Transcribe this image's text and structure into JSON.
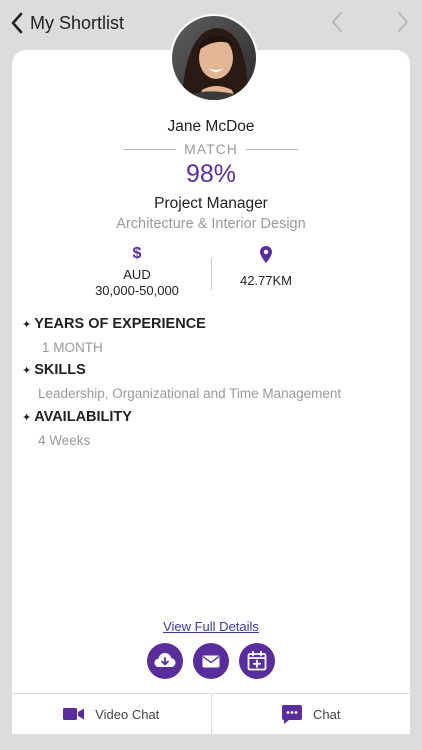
{
  "header": {
    "back_label": "My Shortlist",
    "icons": {
      "back": "chevron-left-icon",
      "prev": "chevron-left-icon",
      "next": "chevron-right-icon"
    }
  },
  "candidate": {
    "name": "Jane McDoe",
    "match_label": "MATCH",
    "match_percent": "98%",
    "job_title": "Project Manager",
    "industry": "Architecture & Interior Design",
    "salary_symbol": "$",
    "salary_currency": "AUD",
    "salary_range": "30,000-50,000",
    "distance": "42.77KM"
  },
  "sections": {
    "experience_title": "YEARS OF EXPERIENCE",
    "experience_value": "1  MONTH",
    "skills_title": "SKILLS",
    "skills_value": "Leadership, Organizational and Time Management",
    "availability_title": "AVAILABILITY",
    "availability_value": "4 Weeks",
    "bullet": "✦"
  },
  "actions": {
    "view_details": "View Full Details",
    "icons": [
      "cloud-download-icon",
      "mail-icon",
      "calendar-add-icon"
    ]
  },
  "bottom": {
    "video_chat": "Video Chat",
    "chat": "Chat"
  },
  "colors": {
    "accent": "#5a2d9c",
    "background": "#dcdcdc",
    "muted_text": "#9a9a9a"
  }
}
